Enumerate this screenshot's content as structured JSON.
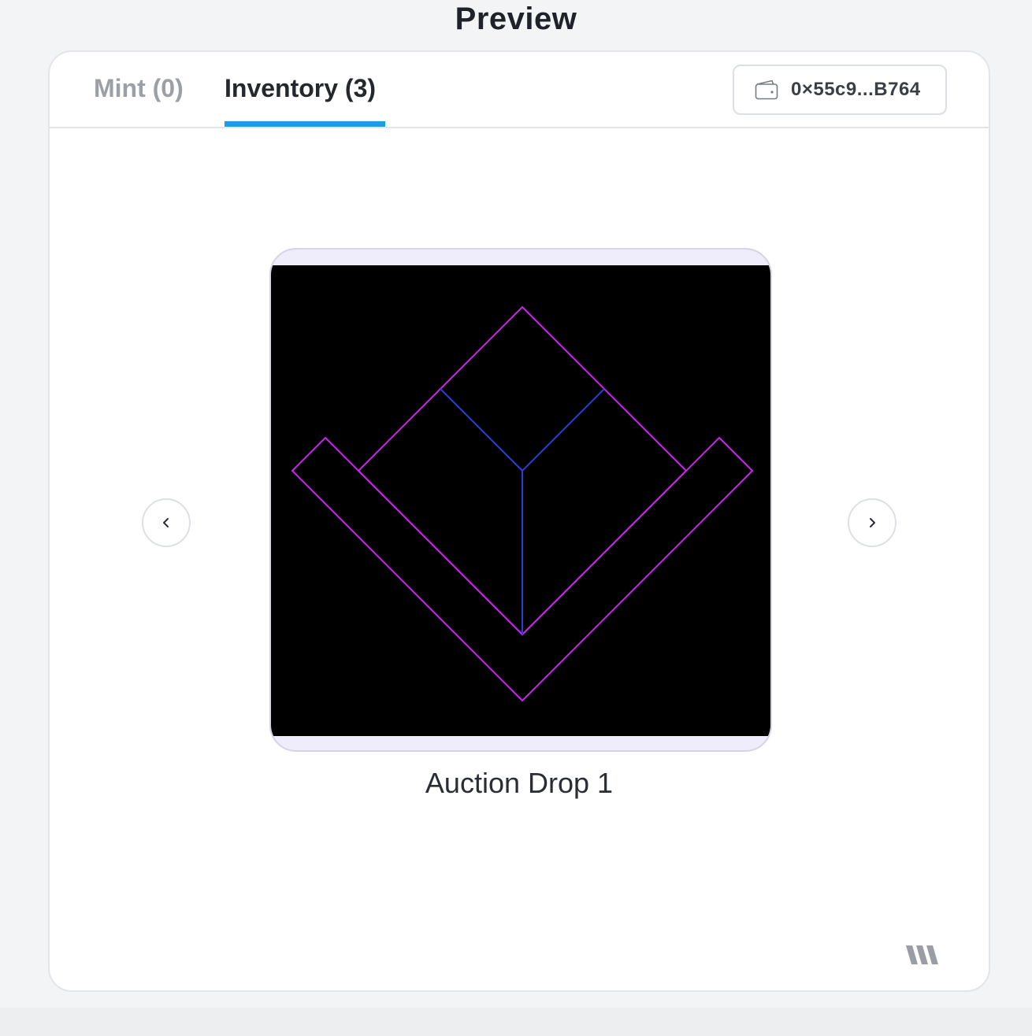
{
  "page": {
    "title": "Preview"
  },
  "tabs": [
    {
      "label": "Mint (0)",
      "active": false
    },
    {
      "label": "Inventory (3)",
      "active": true
    }
  ],
  "wallet": {
    "address": "0×55c9...B764",
    "icon": "wallet-icon"
  },
  "carousel": {
    "prev_icon": "chevron-left-icon",
    "next_icon": "chevron-right-icon",
    "item_name": "Auction Drop 1"
  },
  "colors": {
    "accent": "#1e9ce8",
    "artwork_background": "#000000",
    "artwork_outline": "#cc22ee",
    "artwork_inner_lines": "#2a3fd8",
    "frame_background": "#efedfb"
  },
  "brand": {
    "icon": "brand-logo-icon"
  }
}
